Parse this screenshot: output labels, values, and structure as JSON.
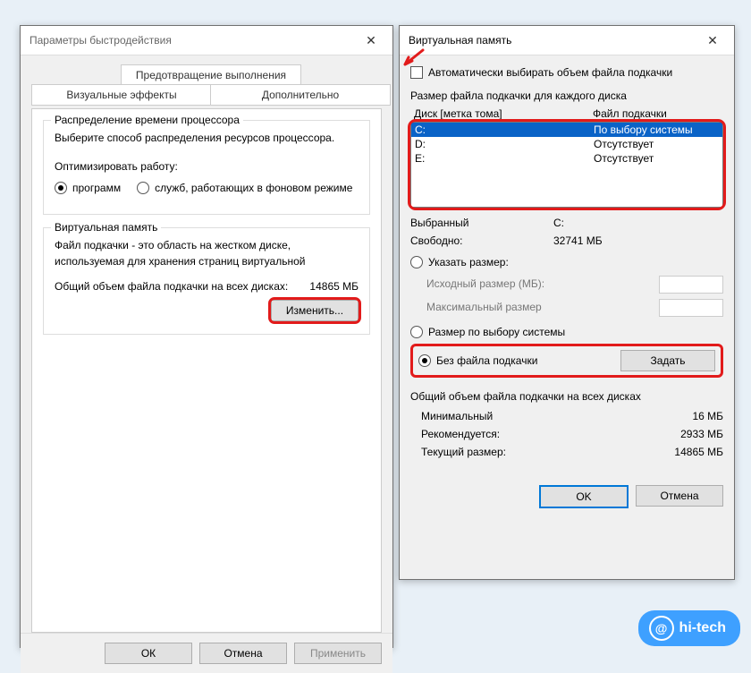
{
  "left": {
    "title": "Параметры быстродействия",
    "tabs": {
      "dep": "Предотвращение выполнения данных",
      "visual": "Визуальные эффекты",
      "advanced": "Дополнительно"
    },
    "cpu": {
      "legend": "Распределение времени процессора",
      "desc": "Выберите способ распределения ресурсов процессора.",
      "optimize": "Оптимизировать работу:",
      "radio_programs": "программ",
      "radio_services": "служб, работающих в фоновом режиме"
    },
    "vm": {
      "legend": "Виртуальная память",
      "desc": "Файл подкачки - это область на жестком диске, используемая для хранения страниц виртуальной",
      "total_label": "Общий объем файла подкачки на всех дисках:",
      "total_value": "14865 МБ",
      "change": "Изменить..."
    },
    "buttons": {
      "ok": "ОК",
      "cancel": "Отмена",
      "apply": "Применить"
    }
  },
  "right": {
    "title": "Виртуальная память",
    "auto": "Автоматически выбирать объем файла подкачки",
    "each": "Размер файла подкачки для каждого диска",
    "col_drive": "Диск [метка тома]",
    "col_paging": "Файл подкачки",
    "drives": [
      {
        "d": "C:",
        "p": "По выбору системы",
        "sel": true
      },
      {
        "d": "D:",
        "p": "Отсутствует",
        "sel": false
      },
      {
        "d": "E:",
        "p": "Отсутствует",
        "sel": false
      }
    ],
    "selected_label": "Выбранный",
    "selected_drive": "C:",
    "free_label": "Свободно:",
    "free_value": "32741 МБ",
    "radio_custom": "Указать размер:",
    "initial_label": "Исходный размер (МБ):",
    "max_label": "Максимальный размер",
    "radio_system": "Размер по выбору системы",
    "radio_none": "Без файла подкачки",
    "set": "Задать",
    "totals_title": "Общий объем файла подкачки на всех дисках",
    "min_label": "Минимальный",
    "min_value": "16 МБ",
    "rec_label": "Рекомендуется:",
    "rec_value": "2933 МБ",
    "cur_label": "Текущий размер:",
    "cur_value": "14865 МБ",
    "ok": "OK",
    "cancel": "Отмена"
  },
  "badge": "hi-tech"
}
